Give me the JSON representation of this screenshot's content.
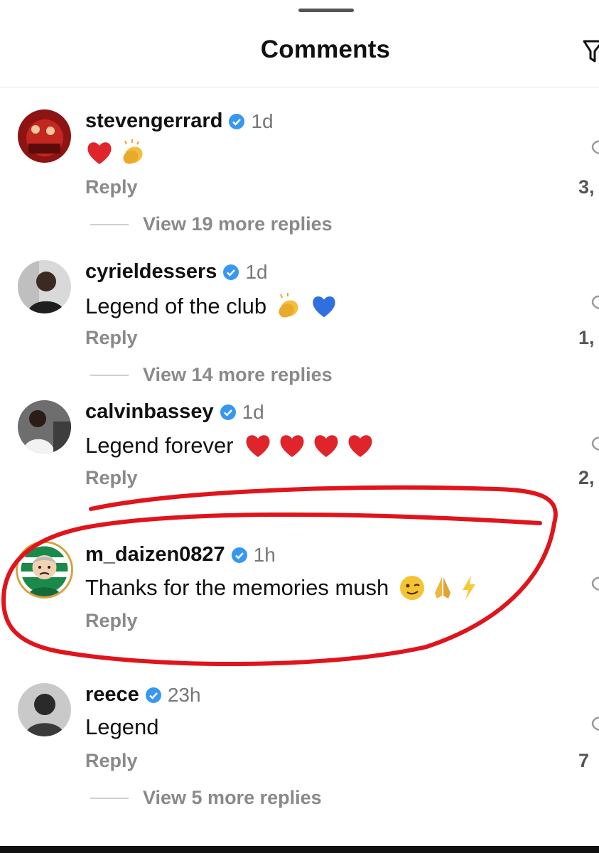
{
  "header": {
    "title": "Comments"
  },
  "comments": [
    {
      "username": "stevengerrard",
      "time": "1d",
      "text": "",
      "emojis": [
        "red-heart",
        "clapping-hands"
      ],
      "reply_label": "Reply",
      "likes": "3,",
      "view_replies": "View 19 more replies"
    },
    {
      "username": "cyrieldessers",
      "time": "1d",
      "text": "Legend of the club",
      "emojis": [
        "clapping-hands",
        "blue-heart"
      ],
      "reply_label": "Reply",
      "likes": "1,",
      "view_replies": "View 14 more replies"
    },
    {
      "username": "calvinbassey",
      "time": "1d",
      "text": "Legend forever",
      "emojis": [
        "red-heart",
        "red-heart",
        "red-heart",
        "red-heart"
      ],
      "reply_label": "Reply",
      "likes": "2,",
      "view_replies": ""
    },
    {
      "username": "m_daizen0827",
      "time": "1h",
      "text": "Thanks for the memories mush",
      "emojis": [
        "winking-face",
        "folded-hands",
        "lightning"
      ],
      "reply_label": "Reply",
      "likes": "",
      "view_replies": ""
    },
    {
      "username": "reece",
      "time": "23h",
      "text": "Legend",
      "emojis": [],
      "reply_label": "Reply",
      "likes": "7",
      "view_replies": "View 5 more replies"
    }
  ],
  "annotation": {
    "highlight_color": "#e0141b",
    "highlighted_comment": "m_daizen0827"
  },
  "colors": {
    "verified_badge": "#3897f0",
    "muted_text": "#8a8a8a"
  }
}
